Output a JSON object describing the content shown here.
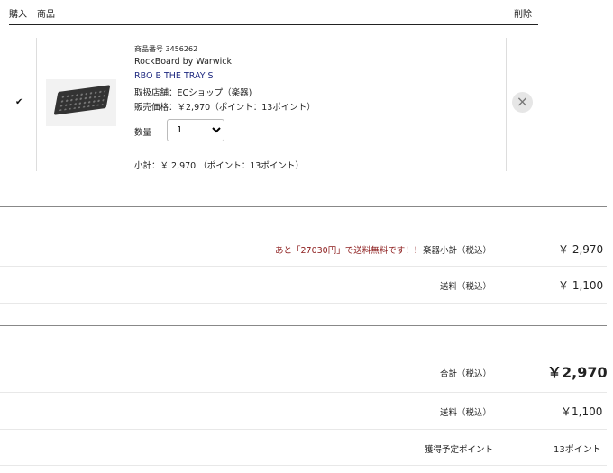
{
  "header": {
    "purchase_label": "購入",
    "product_label": "商品",
    "delete_label": "削除"
  },
  "item": {
    "checked": "✔",
    "product_no": "商品番号 3456262",
    "brand": "RockBoard by Warwick",
    "name": "RBO B THE TRAY S",
    "store": "取扱店舗：ECショップ（楽器)",
    "price": "販売価格：￥2,970（ポイント：13ポイント）",
    "qty_label": "数量",
    "qty_value": "1",
    "subtotal": "小計：￥ 2,970 （ポイント：13ポイント）",
    "delete_glyph": "×"
  },
  "summary1": {
    "free_shipping_msg": "あと「27030円」で送料無料です！！",
    "subtotal_label": "楽器小計（税込）",
    "subtotal_value": "￥ 2,970",
    "shipping_label": "送料（税込）",
    "shipping_value": "￥ 1,100"
  },
  "summary2": {
    "total_label": "合計（税込）",
    "total_value": "￥2,970",
    "shipping_label": "送料（税込）",
    "shipping_value": "￥1,100",
    "points_label": "獲得予定ポイント",
    "points_value": "13ポイント"
  },
  "colors": {
    "accent_navy": "#1f2a80",
    "alert_red": "#8b1a1a"
  },
  "icons": [
    "checkmark-icon",
    "close-icon",
    "chevron-down-icon"
  ]
}
